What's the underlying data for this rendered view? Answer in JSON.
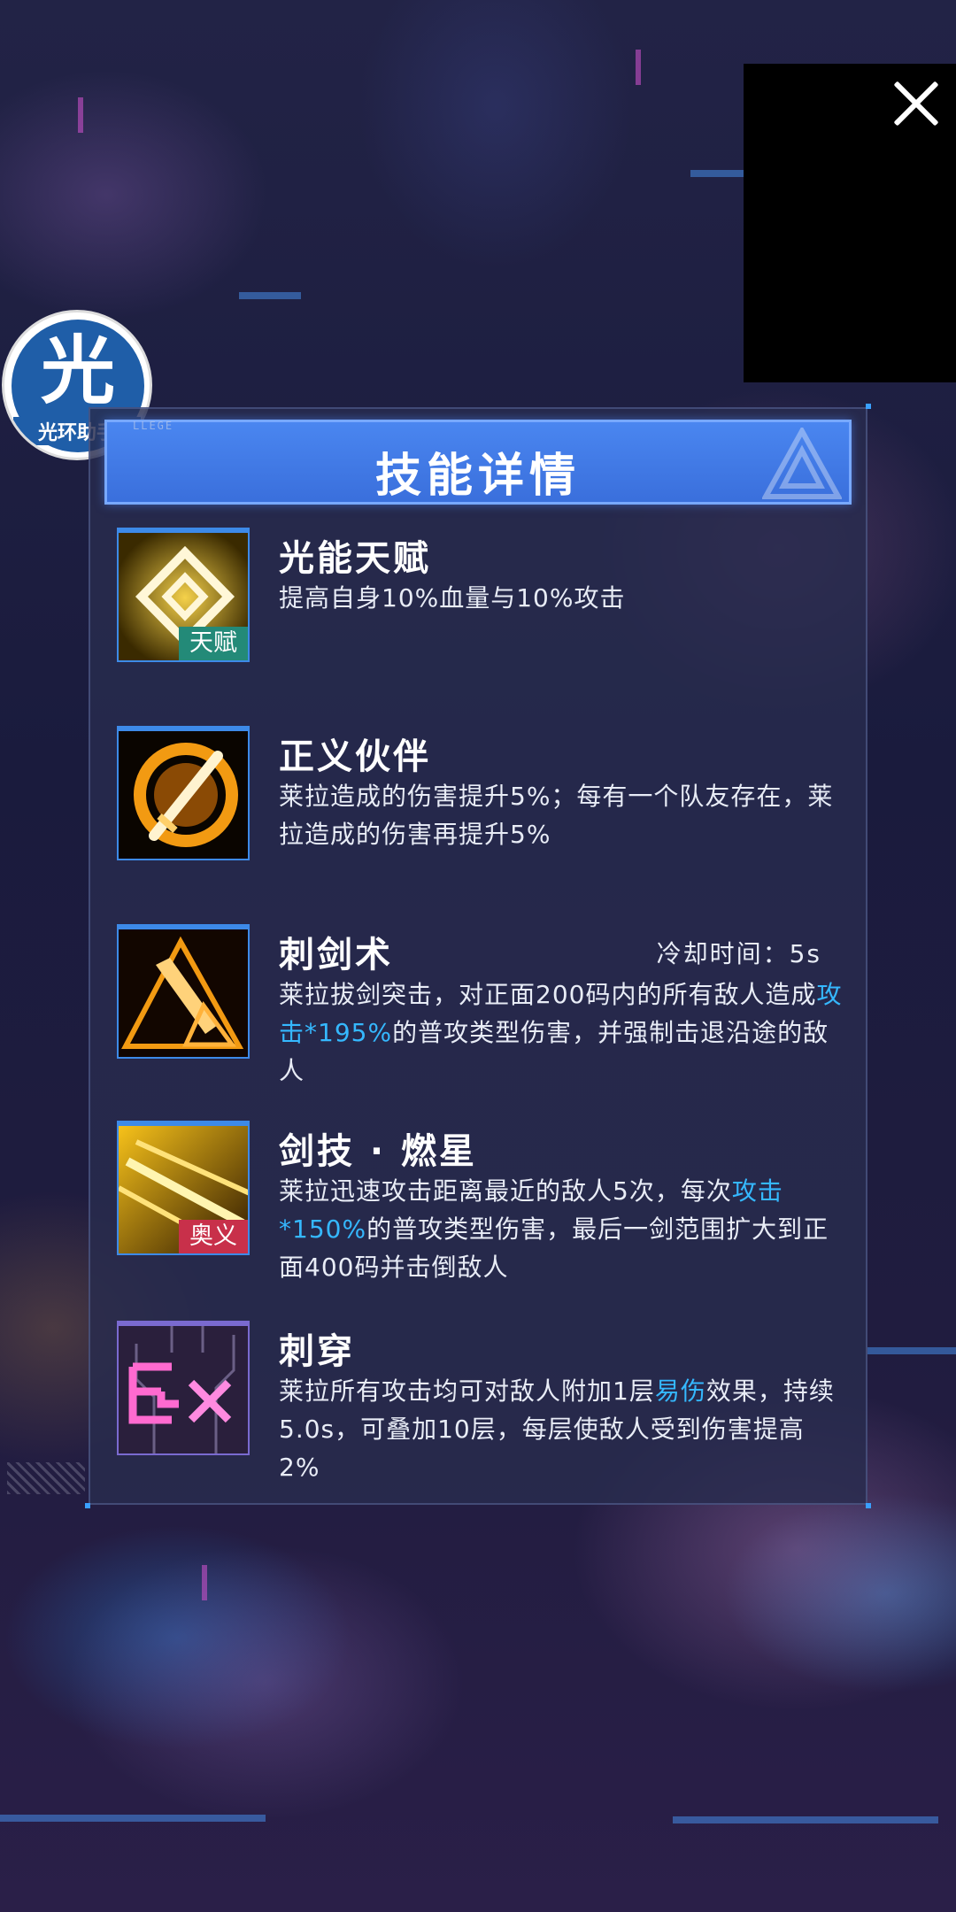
{
  "header": {
    "title": "技能详情",
    "college_text": "LLEGE"
  },
  "watermark": {
    "glyph": "光",
    "text": "光环助手"
  },
  "close": {
    "icon": "close-icon"
  },
  "skills": [
    {
      "name": "光能天赋",
      "tag": "天赋",
      "icon": "diamond-light-icon",
      "desc_parts": [
        "提高自身10%血量与10%攻击"
      ]
    },
    {
      "name": "正义伙伴",
      "icon": "flaming-sword-icon",
      "desc_parts": [
        "莱拉造成的伤害提升5%；每有一个队友存在，莱拉造成的伤害再提升5%"
      ]
    },
    {
      "name": "刺剑术",
      "icon": "sword-triangle-icon",
      "cooldown": "冷却时间：5s",
      "desc_parts": [
        "莱拉拔剑突击，对正面200码内的所有敌人造成",
        "攻击*195%",
        "的普攻类型伤害，并强制击退沿途的敌人"
      ]
    },
    {
      "name": "剑技 · 燃星",
      "tag": "奥义",
      "icon": "burning-star-icon",
      "desc_parts": [
        "莱拉迅速攻击距离最近的敌人5次，每次",
        "攻击*150%",
        "的普攻类型伤害，最后一剑范围扩大到正面400码并击倒敌人"
      ]
    },
    {
      "name": "刺穿",
      "icon": "ex-icon",
      "desc_parts": [
        "莱拉所有攻击均可对敌人附加1层",
        "易伤",
        "效果，持续5.0s，可叠加10层，每层使敌人受到伤害提高2%"
      ]
    }
  ],
  "colors": {
    "highlight": "#35b8ff",
    "header": "#4a86f0",
    "talent_tag": "#238a78",
    "ult_tag": "#c8304a"
  }
}
